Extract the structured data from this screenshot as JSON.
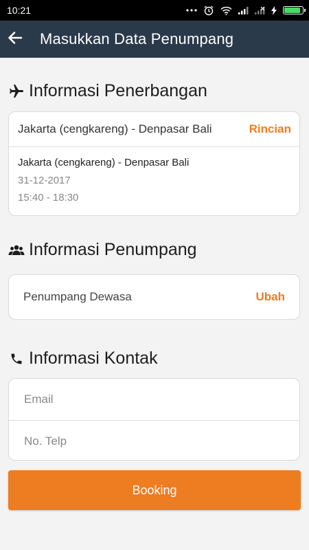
{
  "status_bar": {
    "time": "10:21",
    "icons": [
      "more-dots-icon",
      "alarm-icon",
      "wifi-icon",
      "signal-icon",
      "signal-off-icon",
      "charging-icon",
      "battery-icon"
    ]
  },
  "app_bar": {
    "title": "Masukkan Data Penumpang",
    "back_icon": "back-arrow-icon"
  },
  "flight_info": {
    "heading": "Informasi Penerbangan",
    "icon": "airplane-icon",
    "route": "Jakarta (cengkareng) - Denpasar Bali",
    "detail_link": "Rincian",
    "detail_route": "Jakarta (cengkareng) - Denpasar Bali",
    "date": "31-12-2017",
    "time": "15:40 - 18:30"
  },
  "passenger_info": {
    "heading": "Informasi Penumpang",
    "icon": "people-icon",
    "passenger_label": "Penumpang Dewasa",
    "change_link": "Ubah"
  },
  "contact_info": {
    "heading": "Informasi Kontak",
    "icon": "phone-icon",
    "email_placeholder": "Email",
    "phone_placeholder": "No. Telp"
  },
  "booking_button": {
    "label": "Booking"
  },
  "colors": {
    "accent": "#ee7d22",
    "app_bar": "#2b3a4a",
    "status_bar": "#000000",
    "background": "#f3f3f3"
  }
}
